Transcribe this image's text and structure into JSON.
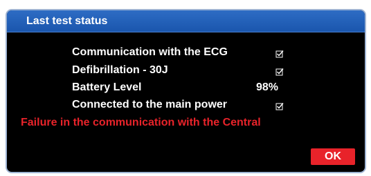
{
  "dialog": {
    "title": "Last test status",
    "items": [
      {
        "label": "Communication with the ECG",
        "status": "check-icon"
      },
      {
        "label": "Defibrillation - 30J",
        "status": "check-icon"
      },
      {
        "label": "Battery Level",
        "value": "98%"
      },
      {
        "label": "Connected to the main power",
        "status": "check-icon"
      }
    ],
    "error_message": "Failure in the communication with the Central",
    "ok_label": "OK"
  },
  "colors": {
    "titlebar": "#1f5db5",
    "background": "#000000",
    "error": "#e8232a",
    "ok_button": "#e8232a"
  }
}
